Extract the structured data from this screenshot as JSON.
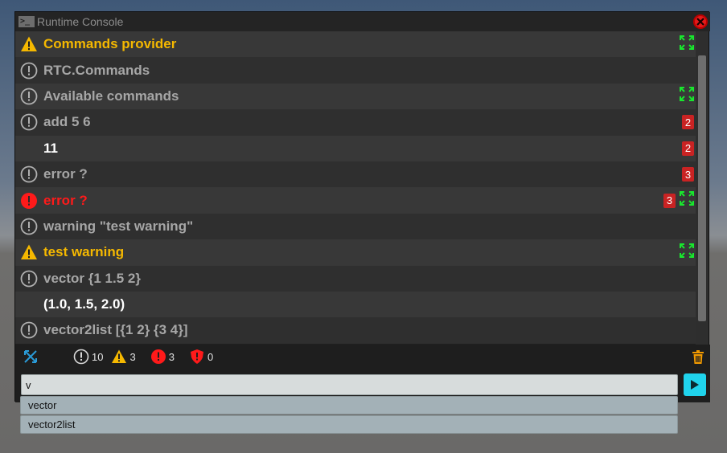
{
  "window": {
    "title": "Runtime Console",
    "title_icon": "terminal-icon"
  },
  "log": [
    {
      "kind": "warn",
      "text": "Commands provider",
      "badge": "",
      "expand": true
    },
    {
      "kind": "info",
      "text": "RTC.Commands",
      "badge": "",
      "expand": false
    },
    {
      "kind": "info",
      "text": "Available commands",
      "badge": "",
      "expand": true
    },
    {
      "kind": "info",
      "text": "add 5 6",
      "badge": "2",
      "expand": false
    },
    {
      "kind": "result",
      "text": "11",
      "badge": "2",
      "expand": false
    },
    {
      "kind": "info",
      "text": "error ?",
      "badge": "3",
      "expand": false
    },
    {
      "kind": "error",
      "text": "error ?",
      "badge": "3",
      "expand": true
    },
    {
      "kind": "info",
      "text": "warning \"test warning\"",
      "badge": "",
      "expand": false
    },
    {
      "kind": "warn",
      "text": "test warning",
      "badge": "",
      "expand": true
    },
    {
      "kind": "info",
      "text": "vector {1 1.5 2}",
      "badge": "",
      "expand": false
    },
    {
      "kind": "result",
      "text": "(1.0, 1.5, 2.0)",
      "badge": "",
      "expand": false
    },
    {
      "kind": "info",
      "text": "vector2list [{1 2} {3 4}]",
      "badge": "",
      "expand": false
    }
  ],
  "toolbar": {
    "info_count": "10",
    "warning_count": "3",
    "error_count": "3",
    "exception_count": "0"
  },
  "input": {
    "value": "v"
  },
  "suggestions": [
    "vector",
    "vector2list"
  ],
  "colors": {
    "info": "#a6a6a6",
    "result": "#ffffff",
    "warning": "#f5b800",
    "error": "#ff1a1a",
    "expand": "#19e62e",
    "run_button": "#20d3ec",
    "trash": "#f29a00",
    "clear_icon": "#2a9bd8"
  }
}
